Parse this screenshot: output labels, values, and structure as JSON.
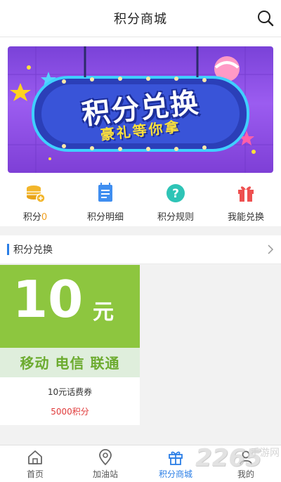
{
  "header": {
    "title": "积分商城"
  },
  "banner": {
    "title": "积分兑换",
    "subtitle": "豪礼等你拿"
  },
  "quick_menu": [
    {
      "label": "积分",
      "count": "0",
      "icon": "coins-icon"
    },
    {
      "label": "积分明细",
      "icon": "points-detail-icon"
    },
    {
      "label": "积分规则",
      "icon": "question-icon"
    },
    {
      "label": "我能兑换",
      "icon": "gift-icon"
    }
  ],
  "section": {
    "title": "积分兑换"
  },
  "product": {
    "image_amount": "10",
    "image_unit": "元",
    "image_carriers": "移动 电信 联通",
    "name": "10元话费券",
    "points": "5000积分"
  },
  "nav": [
    {
      "label": "首页",
      "icon": "home-icon"
    },
    {
      "label": "加油站",
      "icon": "location-pin-icon"
    },
    {
      "label": "积分商城",
      "icon": "gift-icon",
      "active": true
    },
    {
      "label": "我的",
      "icon": "user-icon"
    }
  ],
  "watermark": {
    "main": "2265",
    "sub": "手游网"
  },
  "colors": {
    "accent": "#2a7ee6",
    "points_red": "#e03a3a",
    "card_green": "#8dc63f",
    "count_orange": "#f0a020"
  }
}
